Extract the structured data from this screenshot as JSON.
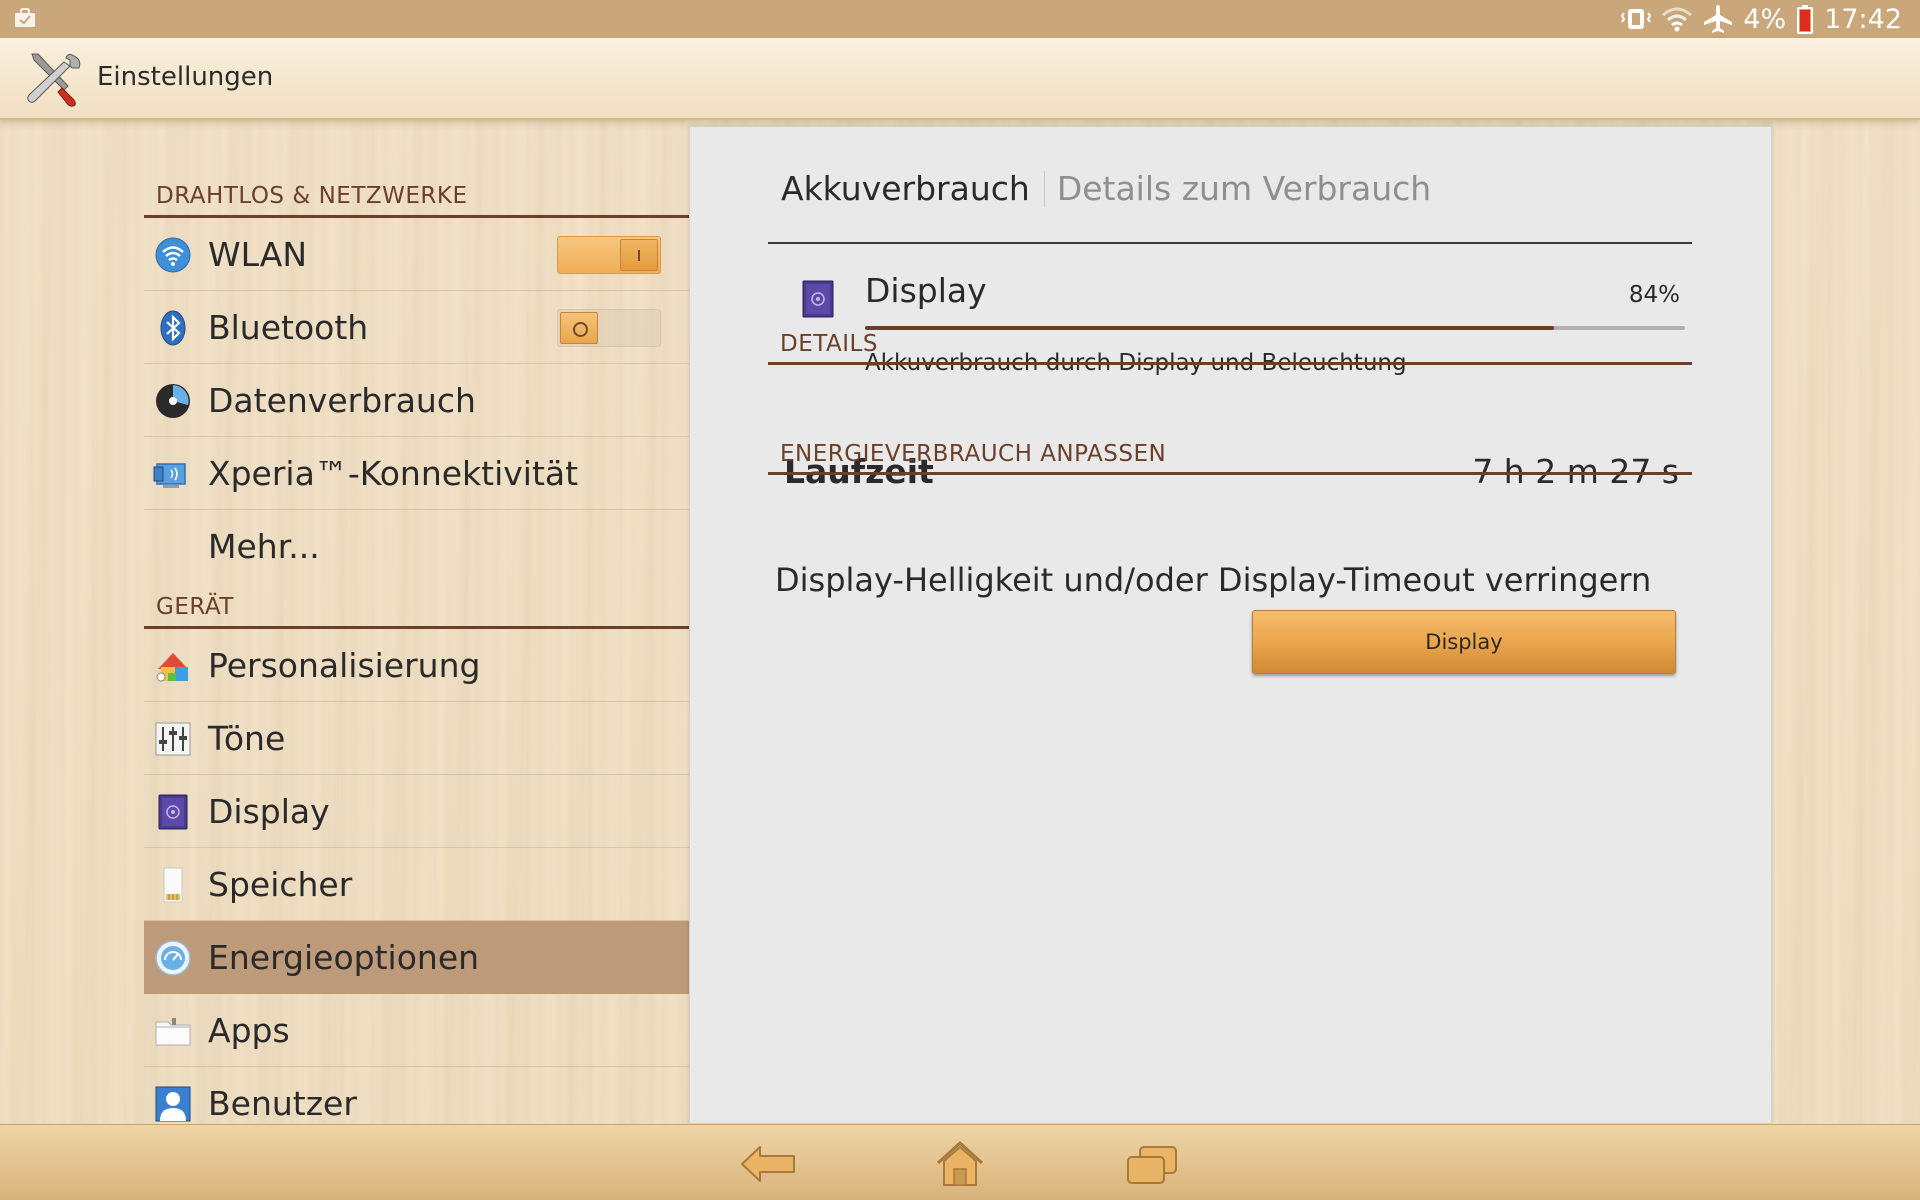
{
  "status_bar": {
    "battery_percent": "4%",
    "time": "17:42",
    "icons": [
      "notification-bag-icon",
      "vibrate-icon",
      "wifi-icon",
      "airplane-icon",
      "battery-low-icon"
    ]
  },
  "action_bar": {
    "title": "Einstellungen",
    "icon": "tools-icon"
  },
  "nav": {
    "section_wireless": "DRAHTLOS & NETZWERKE",
    "section_device": "GERÄT",
    "items": {
      "wlan": {
        "label": "WLAN",
        "icon": "wifi-icon",
        "toggle": "on"
      },
      "bluetooth": {
        "label": "Bluetooth",
        "icon": "bluetooth-icon",
        "toggle": "off"
      },
      "data": {
        "label": "Datenverbrauch",
        "icon": "data-usage-icon"
      },
      "xperia": {
        "label": "Xperia™-Konnektivität",
        "icon": "xperia-connectivity-icon"
      },
      "more": {
        "label": "Mehr..."
      },
      "personal": {
        "label": "Personalisierung",
        "icon": "personalization-icon"
      },
      "sounds": {
        "label": "Töne",
        "icon": "sliders-icon"
      },
      "display": {
        "label": "Display",
        "icon": "display-icon"
      },
      "storage": {
        "label": "Speicher",
        "icon": "sd-card-icon"
      },
      "power": {
        "label": "Energieoptionen",
        "icon": "power-gauge-icon",
        "selected": true
      },
      "apps": {
        "label": "Apps",
        "icon": "apps-folder-icon"
      },
      "users": {
        "label": "Benutzer",
        "icon": "user-icon"
      }
    }
  },
  "panel": {
    "crumb_active": "Akkuverbrauch",
    "crumb_inactive": "Details zum Verbrauch",
    "usage": {
      "name": "Display",
      "percent_label": "84%",
      "percent_value": 84,
      "description": "Akkuverbrauch durch Display und Beleuchtung"
    },
    "details_header": "DETAILS",
    "runtime_label": "Laufzeit",
    "runtime_value": "7 h 2 m 27 s",
    "adjust_header": "ENERGIEVERBRAUCH ANPASSEN",
    "adjust_text": "Display-Helligkeit und/oder Display-Timeout verringern",
    "adjust_button": "Display"
  },
  "navbar": {
    "buttons": [
      "back-icon",
      "home-icon",
      "recent-apps-icon"
    ]
  },
  "colors": {
    "status_bar": "#c9a77a",
    "accent_brown": "#6b3f2a",
    "selected_item": "#bc9a7a",
    "button_orange": "#e9a34b",
    "panel_bg": "#e9e9e9"
  }
}
